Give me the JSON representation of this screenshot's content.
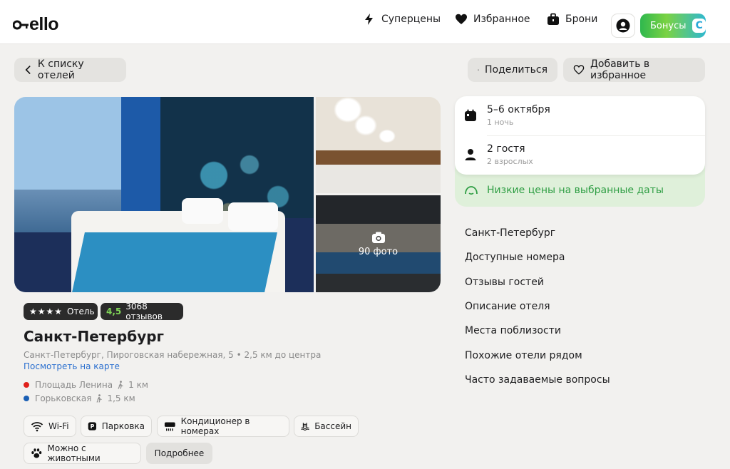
{
  "header": {
    "logo": "ello",
    "nav": [
      {
        "label": "Суперцены",
        "icon": "lightning-icon"
      },
      {
        "label": "Избранное",
        "icon": "heart-icon"
      },
      {
        "label": "Брони",
        "icon": "suitcase-icon"
      }
    ],
    "bonus_label": "Бонусы",
    "bonus_badge": "C"
  },
  "top_actions": {
    "back_label": "К списку отелей",
    "share_label": "Поделиться",
    "favorite_label": "Добавить в избранное"
  },
  "gallery": {
    "photo_count": "90 фото"
  },
  "hotel": {
    "stars": "★★★★",
    "type": "Отель",
    "rating": "4,5",
    "reviews": "3068 отзывов",
    "title": "Санкт-Петербург",
    "address": "Санкт-Петербург, Пироговская набережная, 5 • 2,5 км до центра",
    "map_link": "Посмотреть на карте",
    "metro": [
      {
        "name": "Площадь Ленина",
        "distance": "1 км",
        "color": "#e0201b"
      },
      {
        "name": "Горьковская",
        "distance": "1,5 км",
        "color": "#1a5fb4"
      }
    ],
    "amenities": [
      {
        "label": "Wi-Fi",
        "icon": "wifi-icon"
      },
      {
        "label": "Парковка",
        "icon": "parking-icon"
      },
      {
        "label": "Кондиционер в номерах",
        "icon": "air-conditioner-icon"
      },
      {
        "label": "Бассейн",
        "icon": "pool-icon"
      },
      {
        "label": "Можно с животными",
        "icon": "paw-icon"
      }
    ],
    "more_label": "Подробнее"
  },
  "booking": {
    "dates": "5–6 октября",
    "nights": "1 ночь",
    "guests": "2 гостя",
    "guests_detail": "2 взрослых",
    "low_price": "Низкие цены на выбранные даты"
  },
  "side_nav": [
    "Санкт-Петербург",
    "Доступные номера",
    "Отзывы гостей",
    "Описание отеля",
    "Места поблизости",
    "Похожие отели рядом",
    "Часто задаваемые вопросы"
  ],
  "colors": {
    "accent_green": "#2f9e44",
    "rating_green": "#7fd457",
    "link_blue": "#2a6fcf"
  }
}
